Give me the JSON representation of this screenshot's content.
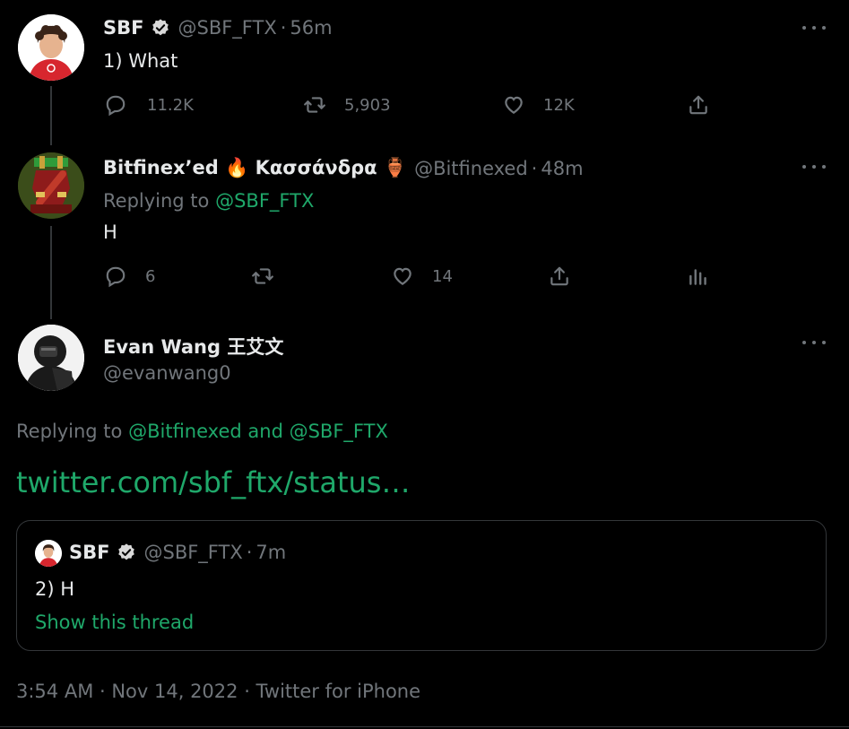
{
  "tweets": [
    {
      "name": "SBF",
      "verified": true,
      "handle": "@SBF_FTX",
      "time": "56m",
      "text": "1) What",
      "replies": "11.2K",
      "retweets": "5,903",
      "likes": "12K"
    },
    {
      "name": "Bitfinex’ed 🔥 Κασσάνδρα 🏺",
      "handle": "@Bitfinexed",
      "time": "48m",
      "replying_label": "Replying to",
      "replying_to": "@SBF_FTX",
      "text": "H",
      "replies": "6",
      "retweets": "",
      "likes": "14"
    }
  ],
  "main": {
    "name": "Evan Wang 王艾文",
    "handle": "@evanwang0",
    "replying_label": "Replying to",
    "replying_user1": "@Bitfinexed",
    "replying_and": "and",
    "replying_user2": "@SBF_FTX",
    "link": "twitter.com/sbf_ftx/status…",
    "timestamp": "3:54 AM · Nov 14, 2022 · Twitter for iPhone"
  },
  "quote": {
    "name": "SBF",
    "verified": true,
    "handle": "@SBF_FTX",
    "time": "7m",
    "text": "2) H",
    "show_thread": "Show this thread"
  },
  "separator": "·",
  "colors": {
    "background": "#000000",
    "text": "#e7e9ea",
    "dim": "#71767b",
    "accent": "#1fa86a",
    "verified": "#d9d9d9"
  }
}
